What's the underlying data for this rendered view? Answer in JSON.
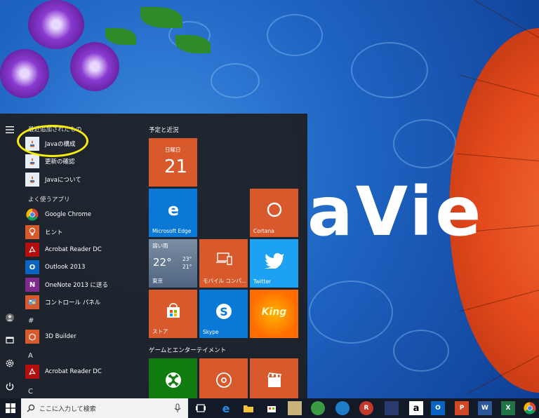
{
  "wallpaper": {
    "logo_text": "aVie"
  },
  "start_menu": {
    "recent_header": "最近追加されたもの",
    "recent_apps": [
      {
        "label": "Javaの構成",
        "icon": "java-icon"
      },
      {
        "label": "更新の確認",
        "icon": "java-icon"
      },
      {
        "label": "Javaについて",
        "icon": "java-icon"
      }
    ],
    "frequent_header": "よく使うアプリ",
    "frequent_apps": [
      {
        "label": "Google Chrome",
        "icon": "chrome-icon"
      },
      {
        "label": "ヒント",
        "icon": "lightbulb-icon"
      },
      {
        "label": "Acrobat Reader DC",
        "icon": "acrobat-icon"
      },
      {
        "label": "Outlook 2013",
        "icon": "outlook-icon"
      },
      {
        "label": "OneNote 2013 に送る",
        "icon": "onenote-icon"
      },
      {
        "label": "コントロール パネル",
        "icon": "control-panel-icon"
      }
    ],
    "hash_header": "#",
    "hash_apps": [
      {
        "label": "3D Builder",
        "icon": "3d-builder-icon"
      }
    ],
    "a_header": "A",
    "a_apps": [
      {
        "label": "Acrobat Reader DC",
        "icon": "acrobat-icon"
      }
    ],
    "c_header": "C"
  },
  "tiles": {
    "group1_title": "予定と近況",
    "calendar": {
      "day_name": "日曜日",
      "day_number": "21"
    },
    "edge_label": "Microsoft Edge",
    "cortana_label": "Cortana",
    "weather": {
      "condition": "弱い雨",
      "temp": "22°",
      "high": "23°",
      "low": "21°",
      "city": "東京"
    },
    "companion_label": "モバイル コンパ...",
    "twitter_label": "Twitter",
    "store_label": "ストア",
    "skype_label": "Skype",
    "king_label": "King",
    "group2_title": "ゲームとエンターテイメント"
  },
  "taskbar": {
    "search_placeholder": "ここに入力して検索",
    "apps": [
      "task-view-icon",
      "edge-icon",
      "file-explorer-icon",
      "store-icon",
      "photo-app-icon",
      "game-app-icon",
      "globe-app-icon",
      "r-app-icon",
      "media-app-icon",
      "amazon-icon",
      "outlook-icon",
      "powerpoint-icon",
      "word-icon",
      "excel-icon",
      "chrome-icon"
    ]
  },
  "colors": {
    "tile_orange": "#d8592c",
    "tile_blue": "#0a78d7",
    "highlight": "#f7ef0a"
  }
}
